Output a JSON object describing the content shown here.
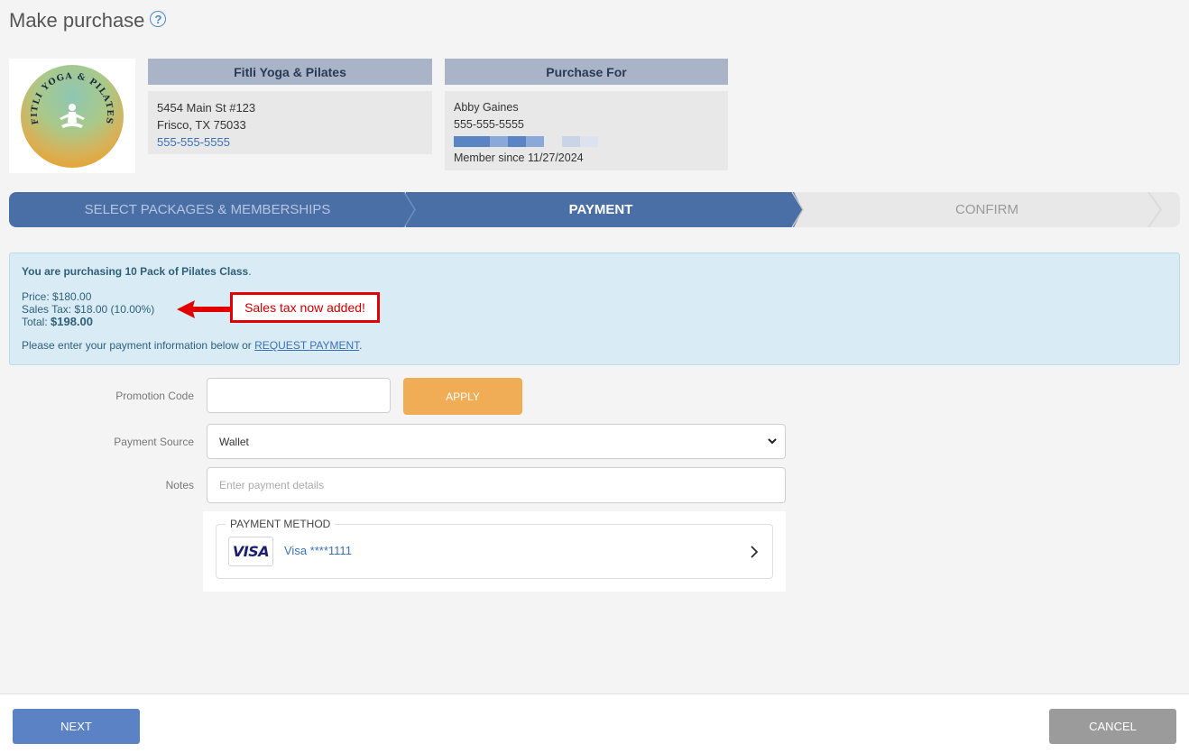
{
  "page": {
    "title": "Make purchase"
  },
  "studio": {
    "logo_text": "FITLI YOGA & PILATES",
    "name": "Fitli Yoga & Pilates",
    "address1": "5454 Main St #123",
    "address2": "Frisco, TX 75033",
    "phone": "555-555-5555"
  },
  "purchase_for": {
    "heading": "Purchase For",
    "name": "Abby Gaines",
    "phone": "555-555-5555",
    "member_since": "Member since 11/27/2024"
  },
  "stepper": {
    "steps": [
      {
        "label": "SELECT PACKAGES & MEMBERSHIPS",
        "state": "completed"
      },
      {
        "label": "PAYMENT",
        "state": "active"
      },
      {
        "label": "CONFIRM",
        "state": "pending"
      }
    ]
  },
  "summary": {
    "intro_prefix": "You are purchasing 10 Pack of Pilates Class",
    "intro_suffix": ".",
    "price_label": "Price: ",
    "price": "$180.00",
    "tax_label": "Sales Tax: ",
    "tax": "$18.00 (10.00%)",
    "total_label": "Total: ",
    "total": "$198.00",
    "payment_note": "Please enter your payment information below or ",
    "request_payment_link": "REQUEST PAYMENT",
    "payment_note_end": "."
  },
  "callout": {
    "text": "Sales tax now added!"
  },
  "form": {
    "promo_label": "Promotion Code",
    "promo_value": "",
    "apply_label": "APPLY",
    "source_label": "Payment Source",
    "source_value": "Wallet",
    "notes_label": "Notes",
    "notes_placeholder": "Enter payment details"
  },
  "payment_method": {
    "legend": "PAYMENT METHOD",
    "brand": "VISA",
    "card_text": "Visa ****1111"
  },
  "footer": {
    "next_label": "NEXT",
    "cancel_label": "CANCEL"
  },
  "colors": {
    "primary": "#4a6ea6",
    "apply": "#f0ad55",
    "callout": "#e00000",
    "alert_bg": "#d9ecf5"
  }
}
